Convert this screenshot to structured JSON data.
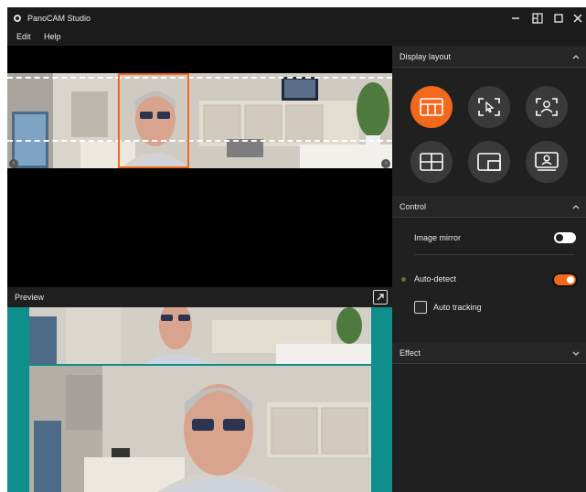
{
  "app": {
    "title": "PanoCAM Studio"
  },
  "menu": {
    "items": [
      "Edit",
      "Help"
    ]
  },
  "window_controls": [
    "minimize-icon",
    "snap-icon",
    "maximize-icon",
    "close-icon"
  ],
  "preview": {
    "label": "Preview"
  },
  "side_panel": {
    "display_layout": {
      "title": "Display layout",
      "selected_index": 0,
      "options": [
        "panorama-layout-icon",
        "pointer-focus-icon",
        "person-focus-icon",
        "grid-layout-icon",
        "picture-in-picture-icon",
        "presenter-icon"
      ]
    },
    "control": {
      "title": "Control",
      "image_mirror": {
        "label": "Image mirror",
        "on": false
      },
      "auto_detect": {
        "label": "Auto-detect",
        "on": true
      },
      "auto_tracking": {
        "label": "Auto tracking",
        "checked": false
      }
    },
    "effect": {
      "title": "Effect"
    }
  },
  "colors": {
    "accent": "#f2681d",
    "teal": "#0f8f8c",
    "panel": "#202020"
  }
}
